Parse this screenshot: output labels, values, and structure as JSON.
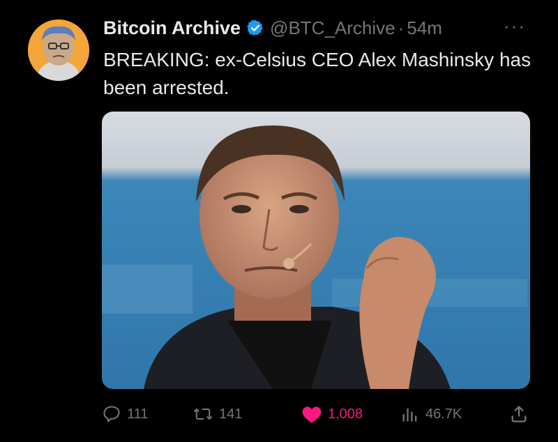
{
  "tweet": {
    "author_name": "Bitcoin Archive",
    "handle": "@BTC_Archive",
    "separator": "·",
    "time": "54m",
    "more": "···",
    "text": "BREAKING: ex-Celsius CEO Alex Mashinsky has been arrested."
  },
  "actions": {
    "replies": "111",
    "reposts": "141",
    "likes": "1,008",
    "views": "46.7K"
  },
  "colors": {
    "background": "#000000",
    "text_primary": "#e7e9ea",
    "text_secondary": "#71767b",
    "verified": "#1d9bf0",
    "like_active": "#f91880",
    "avatar_bg": "#f4a63a"
  },
  "icons": [
    "verified-badge-icon",
    "reply-icon",
    "repost-icon",
    "heart-icon",
    "views-icon",
    "share-icon"
  ]
}
